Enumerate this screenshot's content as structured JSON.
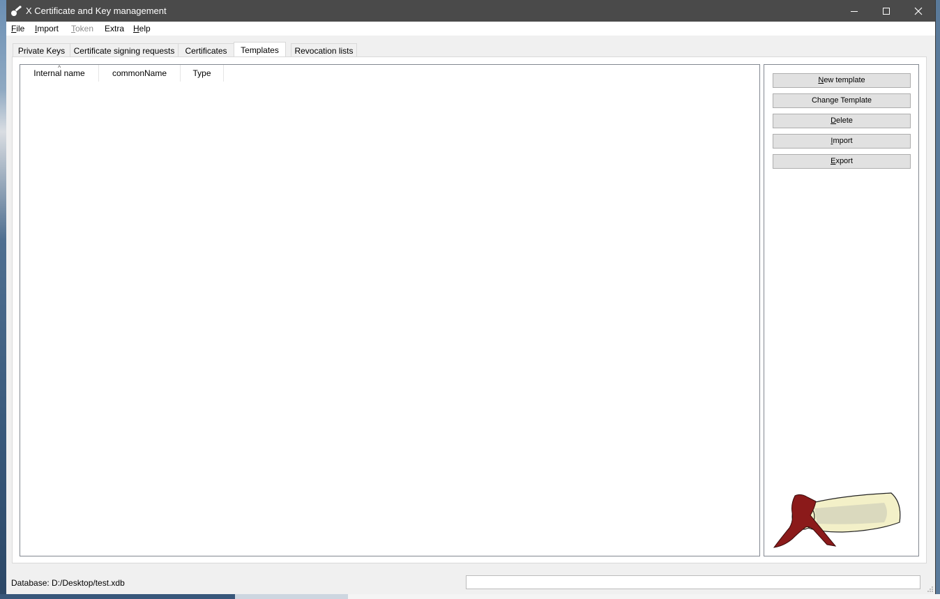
{
  "window": {
    "title": "X Certificate and Key management"
  },
  "menu": [
    {
      "label": "File",
      "accel": "F",
      "rest": "ile",
      "enabled": true
    },
    {
      "label": "Import",
      "accel": "I",
      "rest": "mport",
      "enabled": true
    },
    {
      "label": "Token",
      "accel": "T",
      "rest": "oken",
      "enabled": false
    },
    {
      "label": "Extra",
      "accel": "",
      "rest": "Extra",
      "enabled": true
    },
    {
      "label": "Help",
      "accel": "H",
      "rest": "elp",
      "enabled": true
    }
  ],
  "tabs": [
    {
      "label": "Private Keys",
      "active": false
    },
    {
      "label": "Certificate signing requests",
      "active": false
    },
    {
      "label": "Certificates",
      "active": false
    },
    {
      "label": "Templates",
      "active": true
    },
    {
      "label": "Revocation lists",
      "active": false
    }
  ],
  "table": {
    "columns": [
      "Internal name",
      "commonName",
      "Type"
    ],
    "sort_indicator": "^",
    "rows": []
  },
  "buttons": {
    "new_template": {
      "pre": "",
      "accel": "N",
      "post": "ew template"
    },
    "change_template": {
      "pre": "Chan",
      "accel": "g",
      "post": "e Template"
    },
    "delete": {
      "pre": "",
      "accel": "D",
      "post": "elete"
    },
    "import": {
      "pre": "",
      "accel": "I",
      "post": "mport"
    },
    "export": {
      "pre": "",
      "accel": "E",
      "post": "xport"
    }
  },
  "status": {
    "database": "Database: D:/Desktop/test.xdb"
  },
  "colors": {
    "titlebar": "#4a4a4a",
    "ribbon": "#8b1a1a",
    "scroll": "#f3f0c8"
  },
  "icons": [
    "app-certificate-icon",
    "minimize-icon",
    "maximize-icon",
    "close-icon",
    "scroll-illustration-icon",
    "size-grip-icon"
  ]
}
